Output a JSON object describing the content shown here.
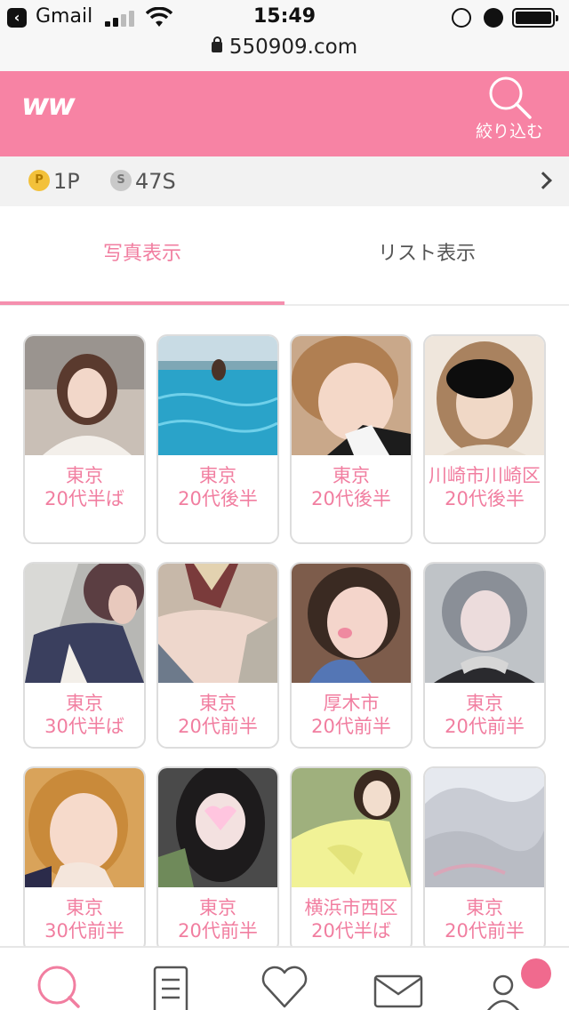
{
  "status_bar": {
    "back_app": "Gmail",
    "time": "15:49"
  },
  "browser": {
    "url": "550909.com"
  },
  "header": {
    "logo": "ww",
    "filter_label": "絞り込む",
    "brand_color": "#f783a4"
  },
  "points": {
    "p_coin": "P",
    "p_value": "1P",
    "s_coin": "S",
    "s_value": "47S"
  },
  "tabs": [
    {
      "label": "写真表示",
      "active": true
    },
    {
      "label": "リスト表示",
      "active": false
    }
  ],
  "profiles": [
    {
      "area": "東京",
      "age": "20代半ば",
      "photo_icon": "woman-portrait"
    },
    {
      "area": "東京",
      "age": "20代後半",
      "photo_icon": "infinity-pool"
    },
    {
      "area": "東京",
      "age": "20代後半",
      "photo_icon": "woman-closeup"
    },
    {
      "area": "川崎市川崎区",
      "age": "20代後半",
      "photo_icon": "woman-censored-face"
    },
    {
      "area": "東京",
      "age": "30代半ば",
      "photo_icon": "woman-blazer"
    },
    {
      "area": "東京",
      "age": "20代前半",
      "photo_icon": "woman-scarf"
    },
    {
      "area": "厚木市",
      "age": "20代前半",
      "photo_icon": "woman-selfie"
    },
    {
      "area": "東京",
      "age": "20代前半",
      "photo_icon": "woman-silver-hair"
    },
    {
      "area": "東京",
      "age": "30代前半",
      "photo_icon": "woman-selfie-smile"
    },
    {
      "area": "東京",
      "age": "20代前半",
      "photo_icon": "woman-heart-sticker"
    },
    {
      "area": "横浜市西区",
      "age": "20代半ば",
      "photo_icon": "woman-yellow-top"
    },
    {
      "area": "東京",
      "age": "20代前半",
      "photo_icon": "fluffy-texture"
    }
  ],
  "bottom_nav": [
    {
      "name": "search",
      "icon": "search-icon",
      "active": true
    },
    {
      "name": "board",
      "icon": "document-icon",
      "active": false
    },
    {
      "name": "favorites",
      "icon": "heart-icon",
      "active": false
    },
    {
      "name": "messages",
      "icon": "mail-icon",
      "active": false
    },
    {
      "name": "mypage",
      "icon": "user-icon",
      "active": false
    }
  ],
  "accent_color": "#f17ea0"
}
